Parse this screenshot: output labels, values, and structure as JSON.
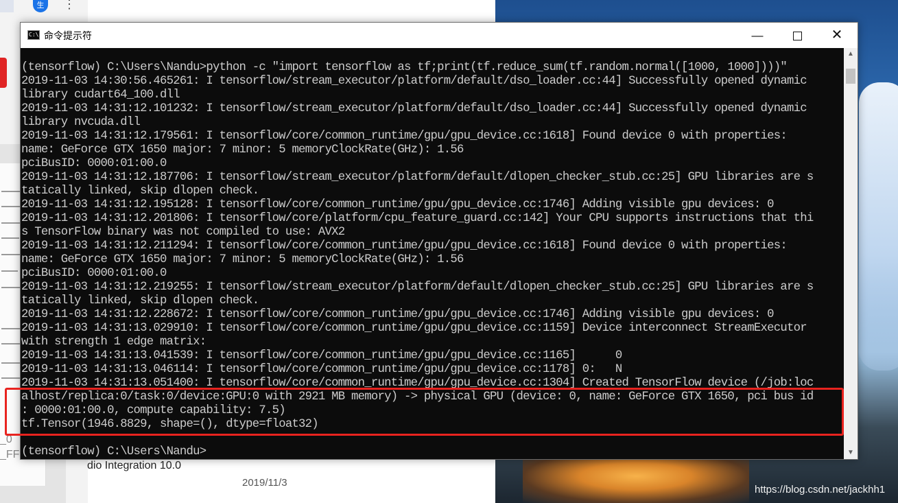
{
  "background": {
    "avatar_letter": "生",
    "kebab": "⋮",
    "text_integration": "dio Integration 10.0",
    "date": "2019/11/3",
    "frag1": "_0",
    "frag2": "_FFF",
    "watermark": "https://blog.csdn.net/jackhh1"
  },
  "window": {
    "title": "命令提示符",
    "icon_text": "C:\\",
    "minimize_glyph": "—",
    "close_glyph": "✕"
  },
  "console": {
    "lines": [
      "(tensorflow) C:\\Users\\Nandu>python -c \"import tensorflow as tf;print(tf.reduce_sum(tf.random.normal([1000, 1000])))\"",
      "2019-11-03 14:30:56.465261: I tensorflow/stream_executor/platform/default/dso_loader.cc:44] Successfully opened dynamic",
      "library cudart64_100.dll",
      "2019-11-03 14:31:12.101232: I tensorflow/stream_executor/platform/default/dso_loader.cc:44] Successfully opened dynamic",
      "library nvcuda.dll",
      "2019-11-03 14:31:12.179561: I tensorflow/core/common_runtime/gpu/gpu_device.cc:1618] Found device 0 with properties:",
      "name: GeForce GTX 1650 major: 7 minor: 5 memoryClockRate(GHz): 1.56",
      "pciBusID: 0000:01:00.0",
      "2019-11-03 14:31:12.187706: I tensorflow/stream_executor/platform/default/dlopen_checker_stub.cc:25] GPU libraries are s",
      "tatically linked, skip dlopen check.",
      "2019-11-03 14:31:12.195128: I tensorflow/core/common_runtime/gpu/gpu_device.cc:1746] Adding visible gpu devices: 0",
      "2019-11-03 14:31:12.201806: I tensorflow/core/platform/cpu_feature_guard.cc:142] Your CPU supports instructions that thi",
      "s TensorFlow binary was not compiled to use: AVX2",
      "2019-11-03 14:31:12.211294: I tensorflow/core/common_runtime/gpu/gpu_device.cc:1618] Found device 0 with properties:",
      "name: GeForce GTX 1650 major: 7 minor: 5 memoryClockRate(GHz): 1.56",
      "pciBusID: 0000:01:00.0",
      "2019-11-03 14:31:12.219255: I tensorflow/stream_executor/platform/default/dlopen_checker_stub.cc:25] GPU libraries are s",
      "tatically linked, skip dlopen check.",
      "2019-11-03 14:31:12.228672: I tensorflow/core/common_runtime/gpu/gpu_device.cc:1746] Adding visible gpu devices: 0",
      "2019-11-03 14:31:13.029910: I tensorflow/core/common_runtime/gpu/gpu_device.cc:1159] Device interconnect StreamExecutor",
      "with strength 1 edge matrix:",
      "2019-11-03 14:31:13.041539: I tensorflow/core/common_runtime/gpu/gpu_device.cc:1165]      0",
      "2019-11-03 14:31:13.046114: I tensorflow/core/common_runtime/gpu/gpu_device.cc:1178] 0:   N",
      "2019-11-03 14:31:13.051400: I tensorflow/core/common_runtime/gpu/gpu_device.cc:1304] Created TensorFlow device (/job:loc",
      "alhost/replica:0/task:0/device:GPU:0 with 2921 MB memory) -> physical GPU (device: 0, name: GeForce GTX 1650, pci bus id",
      ": 0000:01:00.0, compute capability: 7.5)",
      "tf.Tensor(1946.8829, shape=(), dtype=float32)",
      "",
      "(tensorflow) C:\\Users\\Nandu>"
    ]
  },
  "scrollbar": {
    "up_glyph": "▲",
    "down_glyph": "▼"
  },
  "colors": {
    "console_bg": "#0c0c0c",
    "console_fg": "#cccccc",
    "highlight": "#e8231f"
  }
}
